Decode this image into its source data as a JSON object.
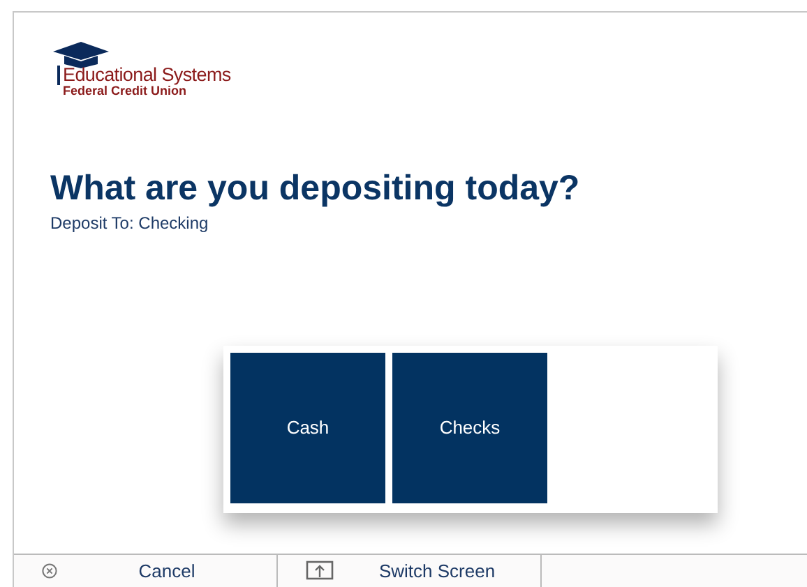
{
  "logo": {
    "name": "Educational Systems",
    "subname": "Federal Credit Union"
  },
  "heading": "What are you depositing today?",
  "subheading": "Deposit To: Checking",
  "options": [
    {
      "label": "Cash"
    },
    {
      "label": "Checks"
    }
  ],
  "footer": [
    {
      "kind": "cancel",
      "label": "Cancel"
    },
    {
      "kind": "switch",
      "label": "Switch Screen"
    }
  ]
}
